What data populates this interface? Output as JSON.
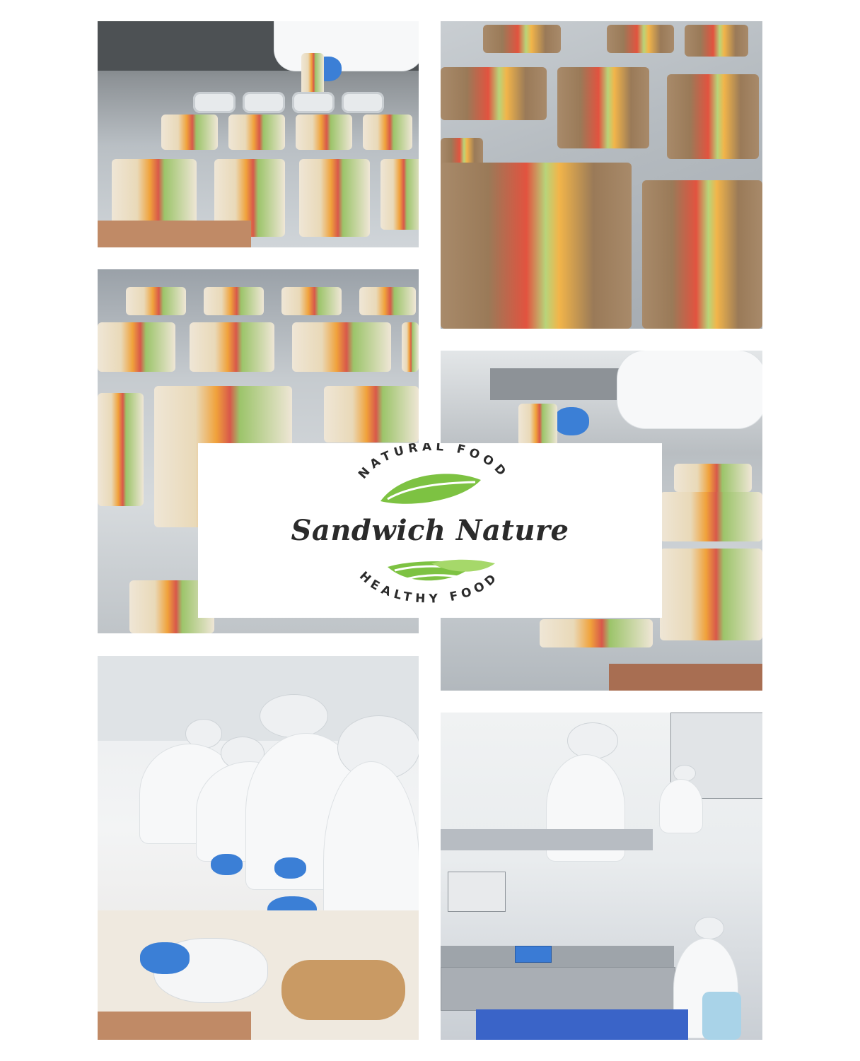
{
  "logo": {
    "top_arc_text": "NATURAL FOOD",
    "brand_name": "Sandwich Nature",
    "bottom_arc_text": "HEALTHY FOOD",
    "colors": {
      "leaf_green": "#7dc242",
      "leaf_light": "#a6d86a",
      "text_dark": "#2b2b2b"
    }
  },
  "photos": [
    {
      "subject": "sandwich-tray-loading"
    },
    {
      "subject": "whole-grain-sandwiches-closeup"
    },
    {
      "subject": "white-bread-sandwich-trays"
    },
    {
      "subject": "tray-sealing-hand"
    },
    {
      "subject": "workers-assembling-sandwiches"
    },
    {
      "subject": "quality-laboratory"
    }
  ],
  "accent_colors": {
    "caption_bar": "#c08a66",
    "caption_bar_dark": "#a86e52"
  }
}
